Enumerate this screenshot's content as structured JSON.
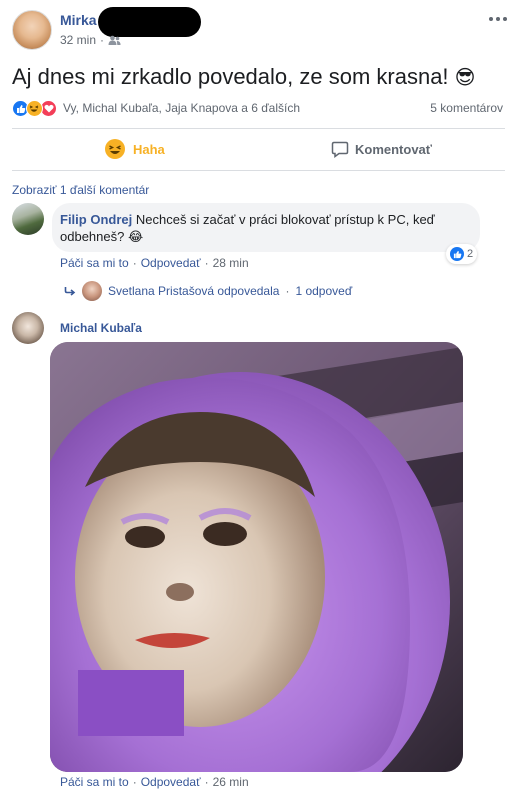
{
  "post": {
    "author": "Mirka",
    "time": "32 min",
    "separator": "·",
    "text": "Aj dnes mi zrkadlo povedalo, ze som krasna!",
    "emoji": "😎",
    "reactions_text": "Vy, Michal Kubaľa, Jaja Knapova a 6 ďalších",
    "comments_count": "5 komentárov",
    "haha_label": "Haha",
    "comment_label": "Komentovať"
  },
  "comments": {
    "more_link": "Zobraziť 1 ďalší komentár",
    "c1": {
      "author": "Filip Ondrej",
      "text": "Nechceš si začať v práci blokovať prístup k PC, keď odbehneš?",
      "emoji": "😂",
      "like": "Páči sa mi to",
      "reply": "Odpovedať",
      "dot": "·",
      "time": "28 min",
      "reaction_count": "2",
      "reply_summary": "Svetlana Pristašová odpovedala",
      "reply_dot": "·",
      "reply_count": "1 odpoveď"
    },
    "c2": {
      "author": "Michal Kubaľa",
      "like": "Páči sa mi to",
      "reply": "Odpovedať",
      "dot": "·",
      "time": "26 min"
    }
  },
  "colors": {
    "fb_blue": "#385898",
    "like_blue": "#1877f2",
    "haha_yellow": "#f7b125",
    "love_red": "#f33e58",
    "bubble_gray": "#f2f3f5",
    "fur_purple": "#b77fe0"
  },
  "icons": [
    "more-icon",
    "friends-icon",
    "like-reaction-icon",
    "haha-reaction-icon",
    "love-reaction-icon",
    "comment-icon",
    "reply-arrow-icon"
  ]
}
